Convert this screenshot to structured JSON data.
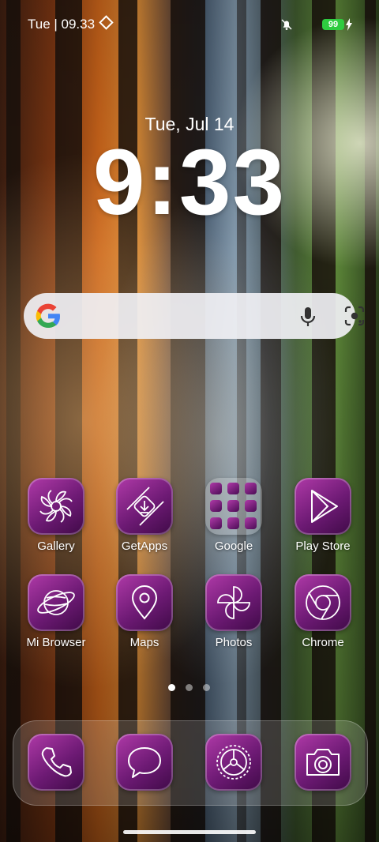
{
  "status_bar": {
    "time": "Tue | 09.33",
    "battery": "99",
    "icons": [
      "diamond-icon",
      "bell-muted-icon",
      "battery-icon",
      "charging-bolt-icon"
    ]
  },
  "lockscreen_widget": {
    "date": "Tue, Jul 14",
    "clock": "9:33"
  },
  "search_bar": {
    "placeholder": "",
    "icons": [
      "google-g-icon",
      "mic-icon",
      "lens-icon"
    ]
  },
  "apps": [
    {
      "label": "Gallery",
      "icon": "gallery-flower-icon"
    },
    {
      "label": "GetApps",
      "icon": "getapps-download-icon"
    },
    {
      "label": "Google",
      "icon": "folder-icon"
    },
    {
      "label": "Play Store",
      "icon": "play-store-icon"
    },
    {
      "label": "Mi Browser",
      "icon": "planet-browser-icon"
    },
    {
      "label": "Maps",
      "icon": "map-pin-icon"
    },
    {
      "label": "Photos",
      "icon": "pinwheel-icon"
    },
    {
      "label": "Chrome",
      "icon": "chrome-icon"
    }
  ],
  "page_indicator": {
    "pages": 3,
    "current": 1
  },
  "dock": [
    {
      "app": "Phone",
      "icon": "phone-icon"
    },
    {
      "app": "Messages",
      "icon": "message-bubble-icon"
    },
    {
      "app": "Settings",
      "icon": "gear-icon"
    },
    {
      "app": "Camera",
      "icon": "camera-icon"
    }
  ],
  "colors": {
    "icon_purple": "#7a1f80",
    "battery_green": "#2ecc40"
  }
}
